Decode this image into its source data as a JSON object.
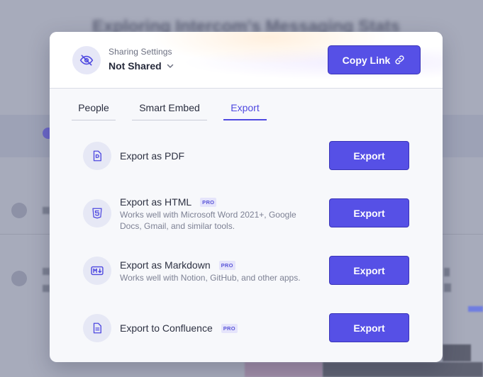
{
  "background": {
    "title": "Exploring Intercom's Messaging Stats"
  },
  "sharing": {
    "caption": "Sharing Settings",
    "state": "Not Shared",
    "copy_link_label": "Copy Link"
  },
  "tabs": [
    {
      "label": "People",
      "active": false
    },
    {
      "label": "Smart Embed",
      "active": false
    },
    {
      "label": "Export",
      "active": true
    }
  ],
  "exports": [
    {
      "title": "Export as PDF",
      "pro": "",
      "description": "",
      "button": "Export",
      "icon": "pdf-file-icon"
    },
    {
      "title": "Export as HTML",
      "pro": "PRO",
      "description": "Works well with Microsoft Word 2021+, Google Docs, Gmail, and similar tools.",
      "button": "Export",
      "icon": "html5-icon"
    },
    {
      "title": "Export as Markdown",
      "pro": "PRO",
      "description": "Works well with Notion, GitHub, and other apps.",
      "button": "Export",
      "icon": "markdown-icon"
    },
    {
      "title": "Export to Confluence",
      "pro": "PRO",
      "description": "",
      "button": "Export",
      "icon": "document-icon"
    }
  ],
  "colors": {
    "accent": "#5650e6",
    "accent_text": "#4f49e0",
    "icon_bg": "#e6e8f5"
  }
}
